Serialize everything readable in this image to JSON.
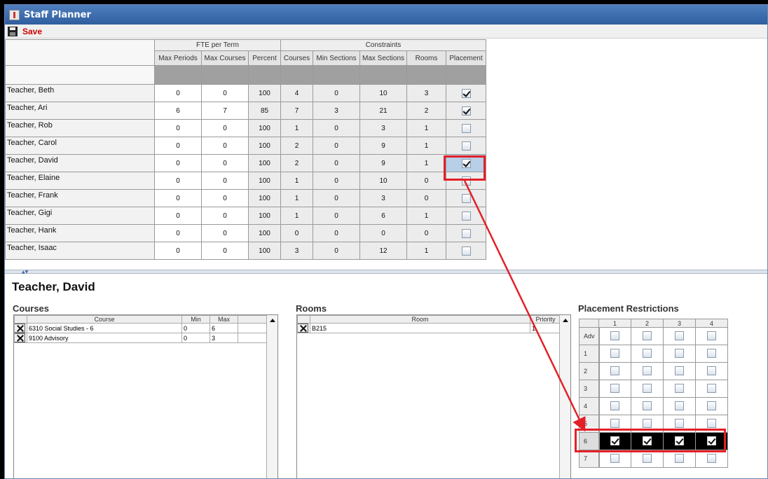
{
  "window": {
    "title": "Staff Planner"
  },
  "toolbar": {
    "save_label": "Save"
  },
  "grid": {
    "groups": {
      "fte": "FTE per Term",
      "constraints": "Constraints"
    },
    "columns": [
      "Max Periods",
      "Max Courses",
      "Percent",
      "Courses",
      "Min Sections",
      "Max Sections",
      "Rooms",
      "Placement"
    ],
    "rows": [
      {
        "name": "Teacher, Beth",
        "vals": [
          "0",
          "0",
          "100",
          "4",
          "0",
          "10",
          "3"
        ],
        "placement": true
      },
      {
        "name": "Teacher, Ari",
        "vals": [
          "6",
          "7",
          "85",
          "7",
          "3",
          "21",
          "2"
        ],
        "placement": true
      },
      {
        "name": "Teacher, Rob",
        "vals": [
          "0",
          "0",
          "100",
          "1",
          "0",
          "3",
          "1"
        ],
        "placement": false
      },
      {
        "name": "Teacher, Carol",
        "vals": [
          "0",
          "0",
          "100",
          "2",
          "0",
          "9",
          "1"
        ],
        "placement": false
      },
      {
        "name": "Teacher, David",
        "vals": [
          "0",
          "0",
          "100",
          "2",
          "0",
          "9",
          "1"
        ],
        "placement": true
      },
      {
        "name": "Teacher, Elaine",
        "vals": [
          "0",
          "0",
          "100",
          "1",
          "0",
          "10",
          "0"
        ],
        "placement": false
      },
      {
        "name": "Teacher, Frank",
        "vals": [
          "0",
          "0",
          "100",
          "1",
          "0",
          "3",
          "0"
        ],
        "placement": false
      },
      {
        "name": "Teacher, Gigi",
        "vals": [
          "0",
          "0",
          "100",
          "1",
          "0",
          "6",
          "1"
        ],
        "placement": false
      },
      {
        "name": "Teacher, Hank",
        "vals": [
          "0",
          "0",
          "100",
          "0",
          "0",
          "0",
          "0"
        ],
        "placement": false
      },
      {
        "name": "Teacher, Isaac",
        "vals": [
          "0",
          "0",
          "100",
          "3",
          "0",
          "12",
          "1"
        ],
        "placement": false
      }
    ]
  },
  "detail": {
    "teacher": "Teacher, David",
    "courses": {
      "title": "Courses",
      "headers": [
        "Course",
        "Min",
        "Max"
      ],
      "rows": [
        {
          "course": "6310 Social Studies - 6",
          "min": "0",
          "max": "6"
        },
        {
          "course": "9100 Advisory",
          "min": "0",
          "max": "3"
        }
      ]
    },
    "rooms": {
      "title": "Rooms",
      "headers": [
        "Room",
        "Priority"
      ],
      "rows": [
        {
          "room": "B215",
          "priority": "1"
        }
      ]
    },
    "placement": {
      "title": "Placement Restrictions",
      "cols": [
        "1",
        "2",
        "3",
        "4"
      ],
      "rows": [
        {
          "label": "Adv",
          "checks": [
            false,
            false,
            false,
            false
          ]
        },
        {
          "label": "1",
          "checks": [
            false,
            false,
            false,
            false
          ]
        },
        {
          "label": "2",
          "checks": [
            false,
            false,
            false,
            false
          ]
        },
        {
          "label": "3",
          "checks": [
            false,
            false,
            false,
            false
          ]
        },
        {
          "label": "4",
          "checks": [
            false,
            false,
            false,
            false
          ]
        },
        {
          "label": "5",
          "checks": [
            false,
            false,
            false,
            false
          ]
        },
        {
          "label": "6",
          "checks": [
            true,
            true,
            true,
            true
          ]
        },
        {
          "label": "7",
          "checks": [
            false,
            false,
            false,
            false
          ]
        }
      ]
    }
  },
  "colors": {
    "annotation": "#e32028",
    "title_bar": "#3a6aad",
    "save_text": "#cc0000"
  }
}
